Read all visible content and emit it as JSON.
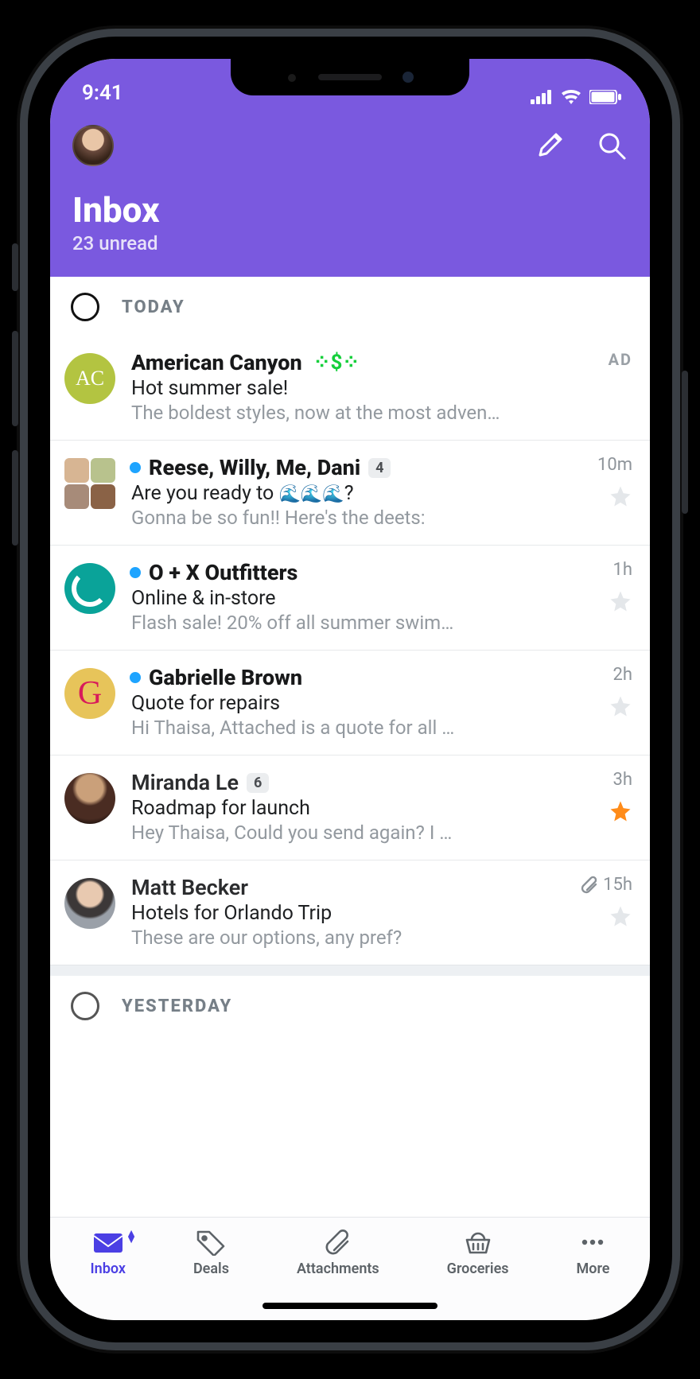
{
  "status": {
    "time": "9:41"
  },
  "header": {
    "title": "Inbox",
    "subtitle": "23 unread"
  },
  "sections": {
    "today": "TODAY",
    "yesterday": "YESTERDAY"
  },
  "messages": [
    {
      "avatar_initials": "AC",
      "sender": "American Canyon",
      "subject": "Hot summer sale!",
      "preview": "The boldest styles, now at the most adven…",
      "tag": "AD",
      "sparkle": true
    },
    {
      "sender": "Reese, Willy, Me, Dani",
      "count": "4",
      "subject_pre": "Are you ready to ",
      "subject_emoji": "🌊🌊🌊",
      "subject_post": "?",
      "preview": "Gonna be so fun!! Here's the deets:",
      "time": "10m",
      "unread": true,
      "starred": false
    },
    {
      "sender": "O + X Outfitters",
      "subject": "Online & in-store",
      "preview": "Flash sale! 20% off all summer swim…",
      "time": "1h",
      "unread": true,
      "starred": false
    },
    {
      "sender": "Gabrielle Brown",
      "subject": "Quote for repairs",
      "preview": "Hi Thaisa, Attached is a quote for all …",
      "time": "2h",
      "unread": true,
      "starred": false
    },
    {
      "sender": "Miranda Le",
      "count": "6",
      "subject": "Roadmap for launch",
      "preview": "Hey Thaisa, Could you send again? I …",
      "time": "3h",
      "unread": false,
      "starred": true
    },
    {
      "sender": "Matt Becker",
      "subject": "Hotels for Orlando Trip",
      "preview": "These are our options, any pref?",
      "time": "15h",
      "unread": false,
      "starred": false,
      "attachment": true
    }
  ],
  "tabs": {
    "inbox": "Inbox",
    "deals": "Deals",
    "attachments": "Attachments",
    "groceries": "Groceries",
    "more": "More"
  }
}
